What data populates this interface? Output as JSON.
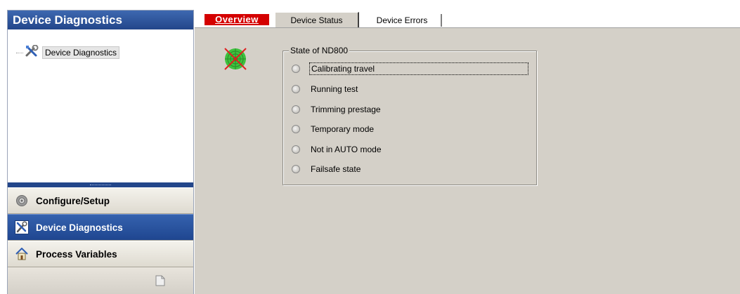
{
  "left_panel": {
    "header_title": "Device Diagnostics",
    "tree": {
      "node_label": "Device Diagnostics",
      "node_icon": "tools-icon"
    },
    "nav": {
      "configure_label": "Configure/Setup",
      "diagnostics_label": "Device Diagnostics",
      "process_label": "Process Variables"
    }
  },
  "tabs": {
    "overview": "Overview",
    "device_status": "Device Status",
    "device_errors": "Device Errors",
    "active": "device_status"
  },
  "state_group": {
    "title": "State of ND800",
    "items": [
      {
        "label": "Calibrating travel",
        "focused": true
      },
      {
        "label": "Running test",
        "focused": false
      },
      {
        "label": "Trimming prestage",
        "focused": false
      },
      {
        "label": "Temporary mode",
        "focused": false
      },
      {
        "label": "Not in AUTO mode",
        "focused": false
      },
      {
        "label": "Failsafe state",
        "focused": false
      }
    ]
  },
  "colors": {
    "header_blue": "#23468a",
    "overview_red": "#d40000",
    "panel_bg": "#d4d0c8"
  }
}
